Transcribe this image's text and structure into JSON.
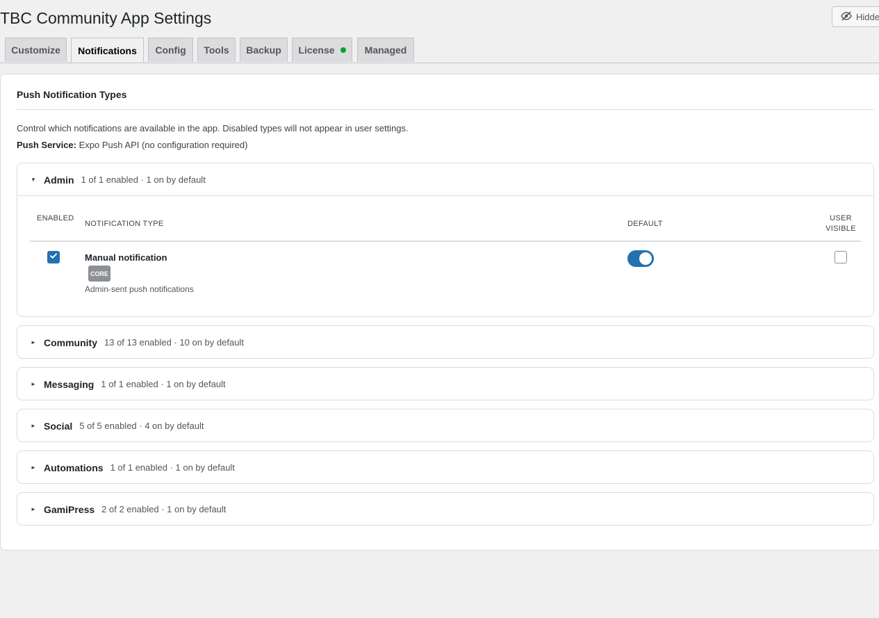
{
  "page": {
    "title": "TBC Community App Settings"
  },
  "header": {
    "hidden_label": "Hidden"
  },
  "tabs": [
    {
      "label": "Customize",
      "active": false
    },
    {
      "label": "Notifications",
      "active": true
    },
    {
      "label": "Config",
      "active": false
    },
    {
      "label": "Tools",
      "active": false
    },
    {
      "label": "Backup",
      "active": false
    },
    {
      "label": "License",
      "active": false,
      "status": "active"
    },
    {
      "label": "Managed",
      "active": false
    }
  ],
  "panel": {
    "heading": "Push Notification Types",
    "description": "Control which notifications are available in the app. Disabled types will not appear in user settings.",
    "service_label": "Push Service:",
    "service_value": "Expo Push API (no configuration required)"
  },
  "table": {
    "headers": {
      "enabled": "ENABLED",
      "type": "NOTIFICATION TYPE",
      "default": "DEFAULT",
      "user_visible_1": "USER",
      "user_visible_2": "VISIBLE"
    }
  },
  "groups": [
    {
      "name": "Admin",
      "meta": "1 of 1 enabled · 1 on by default",
      "expanded": true,
      "rows": [
        {
          "name": "Manual notification",
          "badge": "CORE",
          "description": "Admin-sent push notifications",
          "enabled": true,
          "default_on": true,
          "user_visible": false
        }
      ]
    },
    {
      "name": "Community",
      "meta": "13 of 13 enabled · 10 on by default",
      "expanded": false
    },
    {
      "name": "Messaging",
      "meta": "1 of 1 enabled · 1 on by default",
      "expanded": false
    },
    {
      "name": "Social",
      "meta": "5 of 5 enabled · 4 on by default",
      "expanded": false
    },
    {
      "name": "Automations",
      "meta": "1 of 1 enabled · 1 on by default",
      "expanded": false
    },
    {
      "name": "GamiPress",
      "meta": "2 of 2 enabled · 1 on by default",
      "expanded": false
    }
  ],
  "icons": {
    "hidden": "eye-slash-icon",
    "expanded_caret": "caret-down-icon",
    "collapsed_caret": "caret-right-icon",
    "check": "check-icon"
  },
  "colors": {
    "accent": "#2271b1",
    "status_active": "#00a32a",
    "badge": "#8c8f94"
  }
}
